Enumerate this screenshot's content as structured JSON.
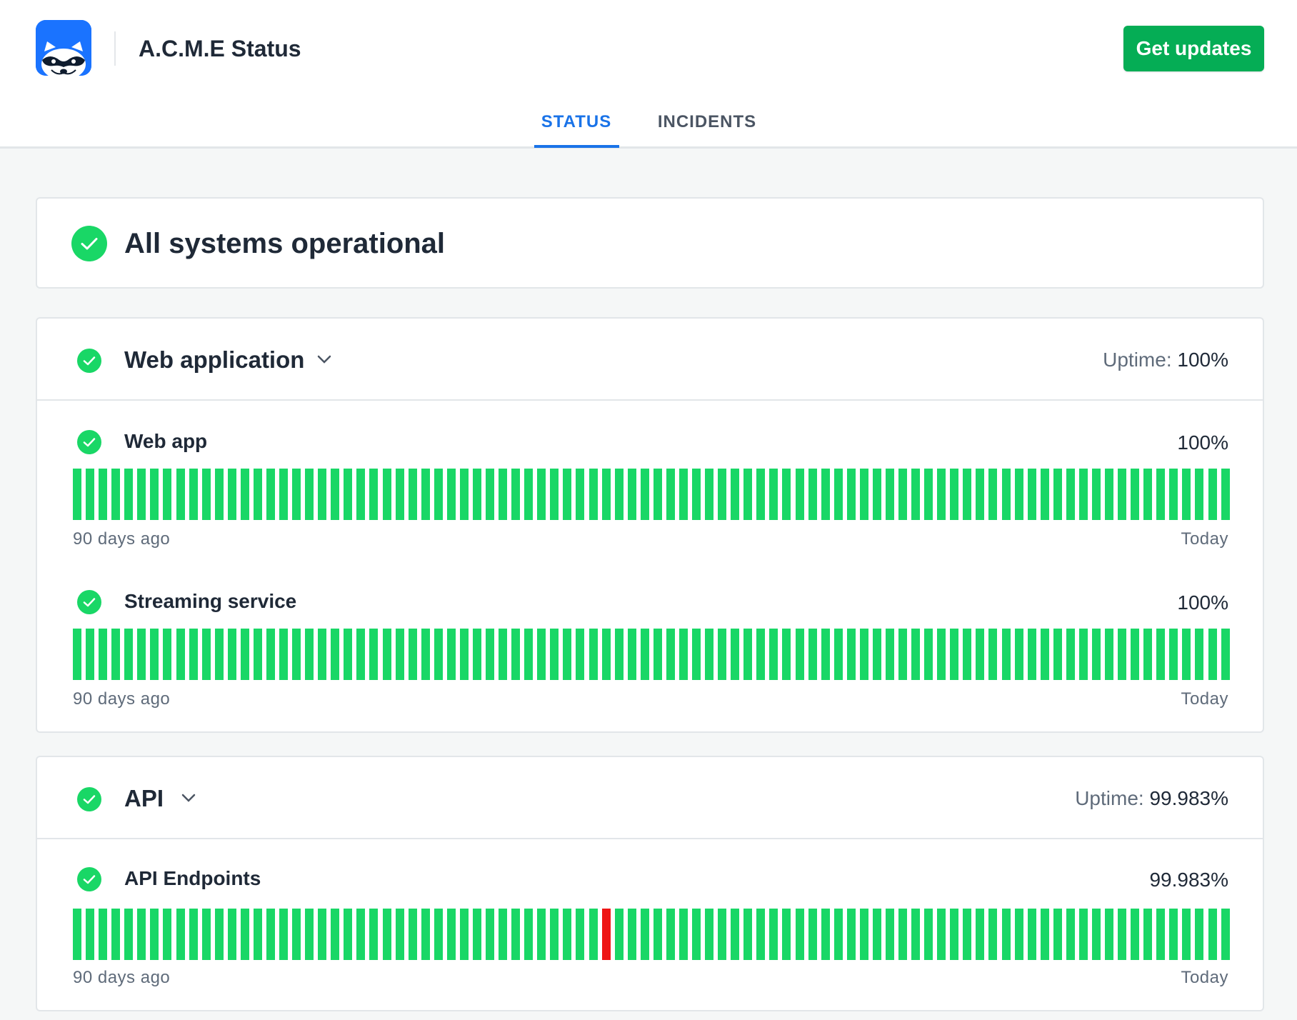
{
  "header": {
    "title": "A.C.M.E Status",
    "logo_icon": "raccoon-logo",
    "get_updates_label": "Get updates",
    "brand_color": "#1a73ff",
    "button_color": "#05ad55"
  },
  "tabs": [
    {
      "label": "STATUS",
      "active": true
    },
    {
      "label": "INCIDENTS",
      "active": false
    }
  ],
  "overall": {
    "text": "All systems operational",
    "icon": "check-circle-icon",
    "status_color": "#19d766"
  },
  "groups": [
    {
      "title": "Web application",
      "uptime_label": "Uptime:",
      "uptime_value": "100%",
      "services": [
        {
          "name": "Web app",
          "percent": "100%",
          "start_label": "90 days ago",
          "end_label": "Today",
          "outage_days": []
        },
        {
          "name": "Streaming service",
          "percent": "100%",
          "start_label": "90 days ago",
          "end_label": "Today",
          "outage_days": []
        }
      ]
    },
    {
      "title": "API",
      "uptime_label": "Uptime:",
      "uptime_value": "99.983%",
      "services": [
        {
          "name": "API Endpoints",
          "percent": "99.983%",
          "start_label": "90 days ago",
          "end_label": "Today",
          "outage_days": [
            41
          ]
        }
      ]
    }
  ],
  "bar_days": 90,
  "colors": {
    "operational": "#19d766",
    "outage": "#ee1515"
  }
}
